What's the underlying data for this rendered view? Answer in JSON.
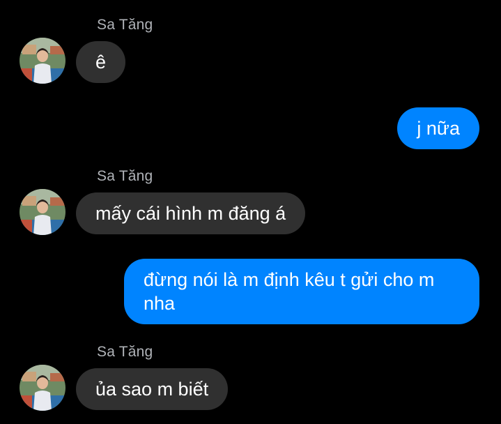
{
  "theme": {
    "background": "#000000",
    "incoming_bubble": "#303030",
    "outgoing_bubble": "#0084ff",
    "sender_name_color": "#b0b3b8"
  },
  "messages": [
    {
      "direction": "incoming",
      "sender": "Sa Tăng",
      "avatar": "profile-photo",
      "text": "ê"
    },
    {
      "direction": "outgoing",
      "text": "j nữa"
    },
    {
      "direction": "incoming",
      "sender": "Sa Tăng",
      "avatar": "profile-photo",
      "text": "mấy cái hình m đăng á"
    },
    {
      "direction": "outgoing",
      "text": "đừng nói là m định kêu t gửi cho m nha"
    },
    {
      "direction": "incoming",
      "sender": "Sa Tăng",
      "avatar": "profile-photo",
      "text": "ủa sao m biết"
    }
  ]
}
